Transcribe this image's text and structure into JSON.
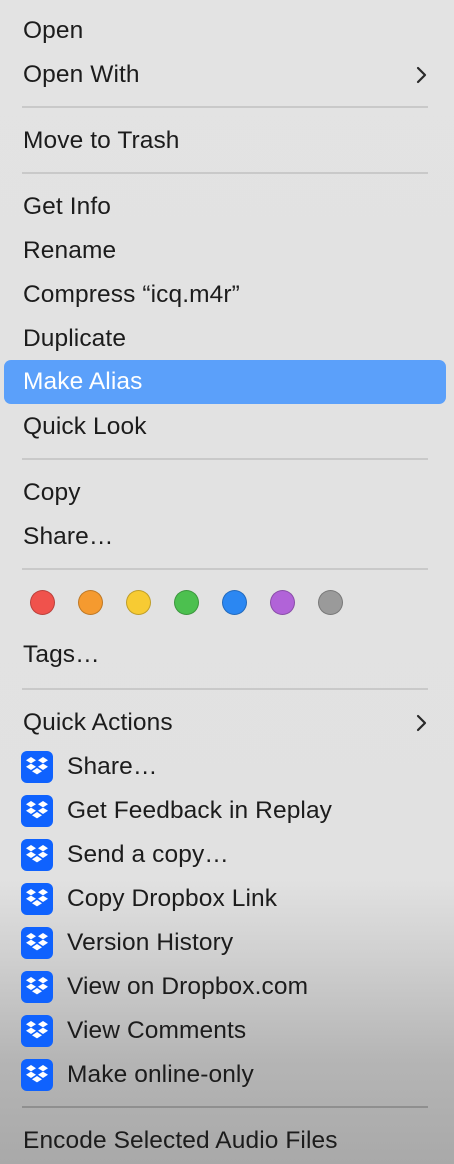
{
  "menu": {
    "items": [
      {
        "label": "Open"
      },
      {
        "label": "Open With"
      },
      {
        "label": "Move to Trash"
      },
      {
        "label": "Get Info"
      },
      {
        "label": "Rename"
      },
      {
        "label": "Compress “icq.m4r”"
      },
      {
        "label": "Duplicate"
      },
      {
        "label": "Make Alias"
      },
      {
        "label": "Quick Look"
      },
      {
        "label": "Copy"
      },
      {
        "label": "Share…"
      },
      {
        "label": "Tags…"
      },
      {
        "label": "Quick Actions"
      },
      {
        "label": "Share…"
      },
      {
        "label": "Get Feedback in Replay"
      },
      {
        "label": "Send a copy…"
      },
      {
        "label": "Copy Dropbox Link"
      },
      {
        "label": "Version History"
      },
      {
        "label": "View on Dropbox.com"
      },
      {
        "label": "View Comments"
      },
      {
        "label": "Make online-only"
      },
      {
        "label": "Encode Selected Audio Files"
      }
    ],
    "highlighted_item": "Make Alias",
    "tag_colors": [
      {
        "name": "red",
        "color": "#f0524c"
      },
      {
        "name": "orange",
        "color": "#f59a2f"
      },
      {
        "name": "yellow",
        "color": "#f7cb33"
      },
      {
        "name": "green",
        "color": "#4cc04f"
      },
      {
        "name": "blue",
        "color": "#2b87f2"
      },
      {
        "name": "purple",
        "color": "#b163d8"
      },
      {
        "name": "gray",
        "color": "#9a9a9a"
      }
    ],
    "submenu_icon": "chevron-right-icon",
    "extension_icon": "dropbox-icon",
    "highlight_color": "#5ba0fa"
  }
}
